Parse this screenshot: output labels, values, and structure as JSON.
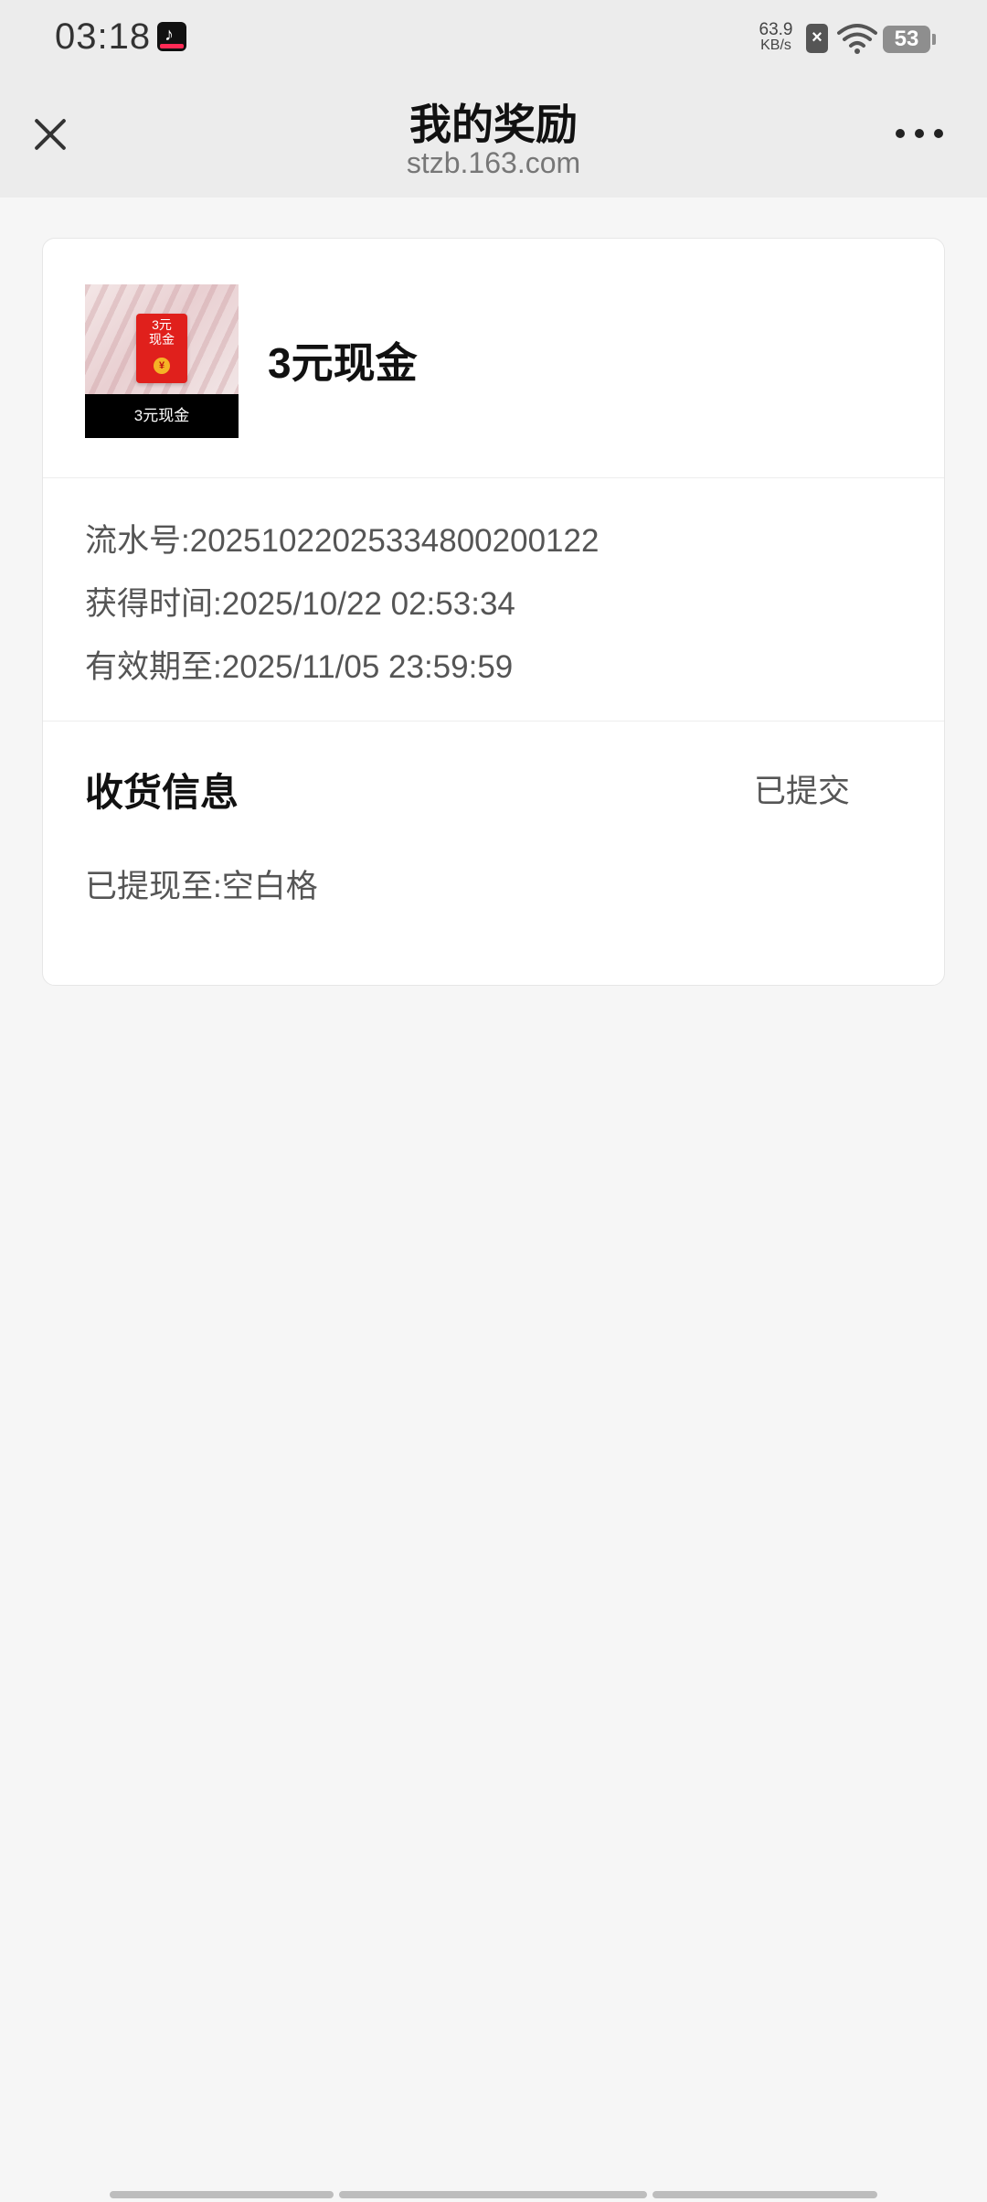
{
  "status_bar": {
    "time": "03:18",
    "net_speed_value": "63.9",
    "net_speed_unit": "KB/s",
    "battery": "53"
  },
  "title_bar": {
    "title": "我的奖励",
    "subtitle": "stzb.163.com"
  },
  "reward": {
    "name": "3元现金",
    "thumb_envelope_text": "3元\n现金",
    "thumb_caption": "3元现金",
    "serial_label": "流水号:",
    "serial_value": "20251022025334800200122",
    "obtained_label": "获得时间:",
    "obtained_value": "2025/10/22 02:53:34",
    "expire_label": "有效期至:",
    "expire_value": "2025/11/05 23:59:59"
  },
  "delivery": {
    "title": "收货信息",
    "status": "已提交",
    "withdraw_label": "已提现至:",
    "withdraw_value": "空白格"
  }
}
